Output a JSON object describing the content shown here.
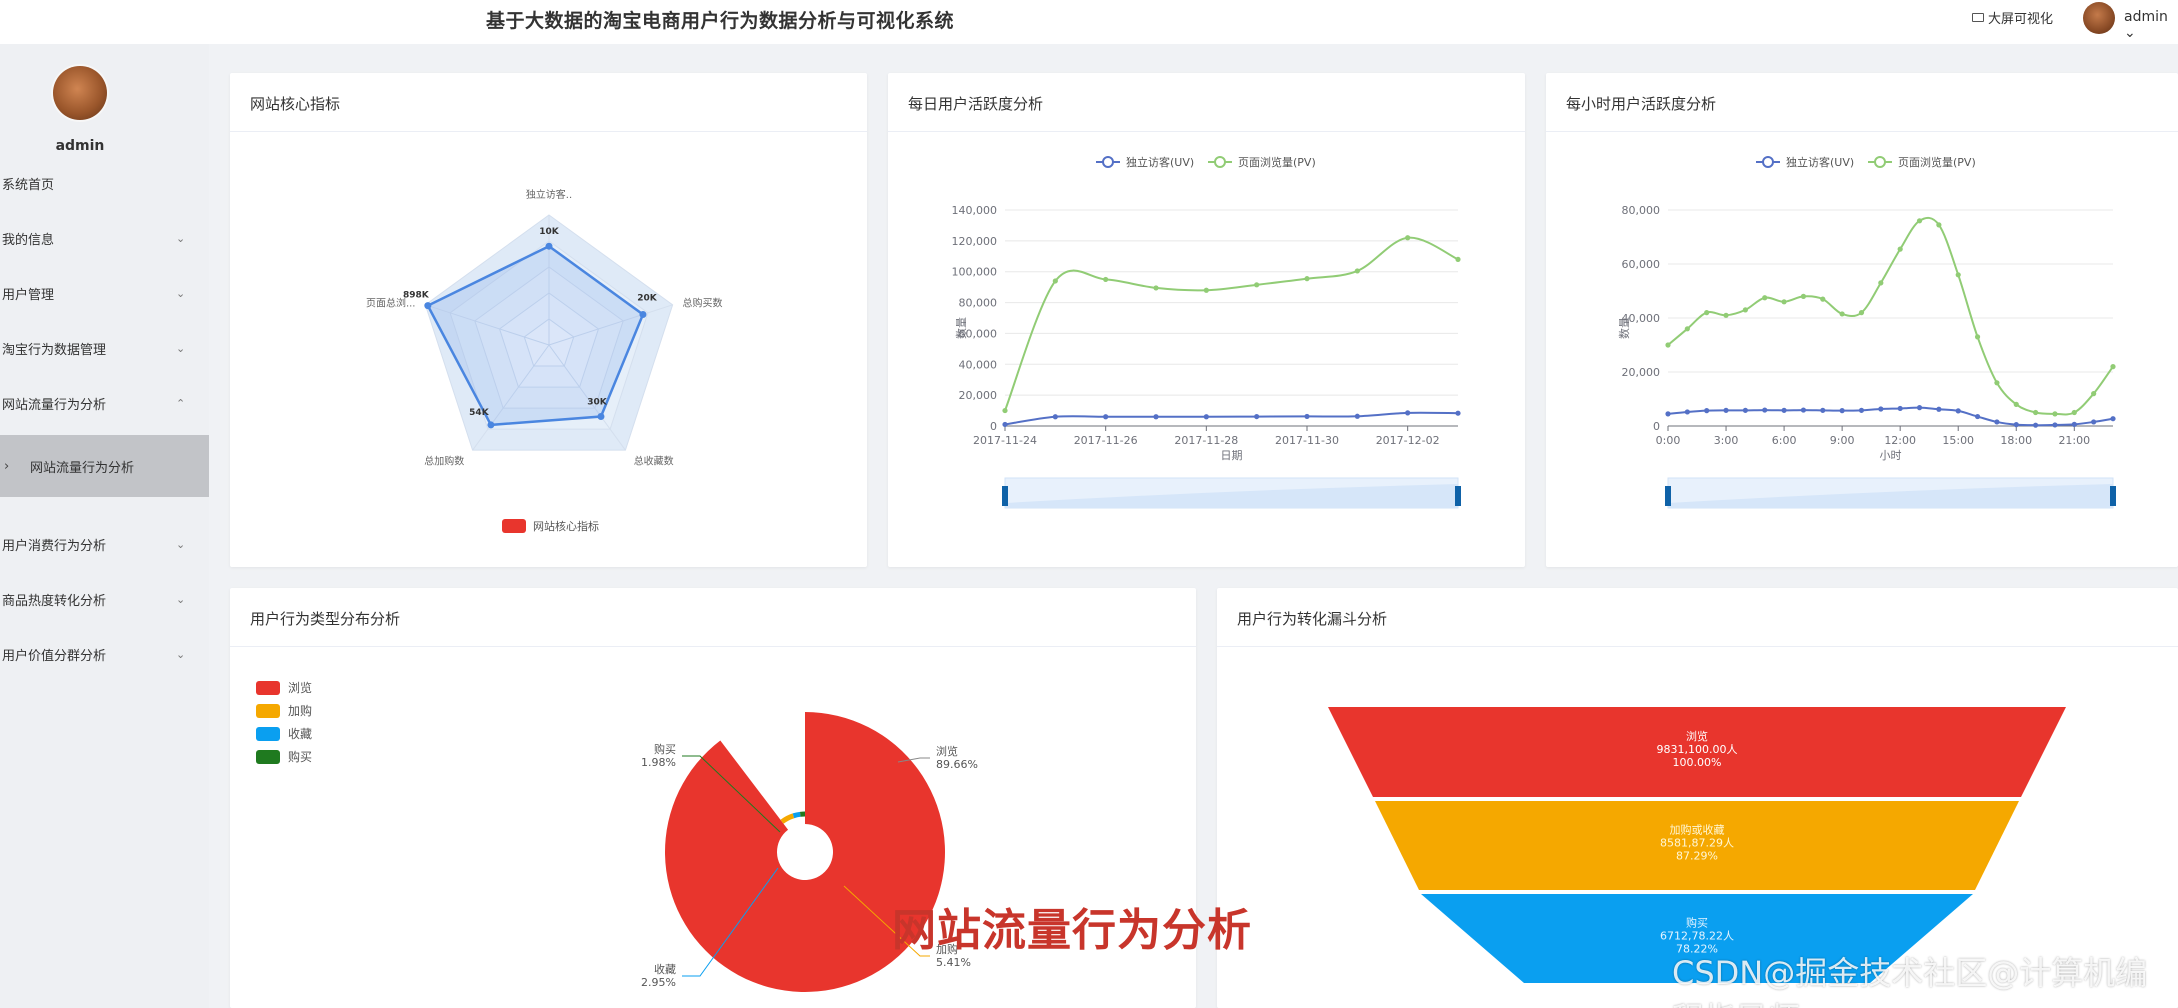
{
  "header": {
    "title": "基于大数据的淘宝电商用户行为数据分析与可视化系统",
    "bigscreen_label": "大屏可视化",
    "user_label": "admin"
  },
  "sidebar": {
    "username": "admin",
    "items": [
      {
        "label": "系统首页",
        "chevron": ""
      },
      {
        "label": "我的信息",
        "chevron": "⌄"
      },
      {
        "label": "用户管理",
        "chevron": "⌄"
      },
      {
        "label": "淘宝行为数据管理",
        "chevron": "⌄"
      },
      {
        "label": "网站流量行为分析",
        "chevron": "⌃"
      },
      {
        "label": "网站流量行为分析",
        "chevron": "",
        "active": true
      },
      {
        "label": "用户消费行为分析",
        "chevron": "⌄"
      },
      {
        "label": "商品热度转化分析",
        "chevron": "⌄"
      },
      {
        "label": "用户价值分群分析",
        "chevron": "⌄"
      }
    ]
  },
  "panels": {
    "radar_title": "网站核心指标",
    "daily_title": "每日用户活跃度分析",
    "hourly_title": "每小时用户活跃度分析",
    "pie_title": "用户行为类型分布分析",
    "funnel_title": "用户行为转化漏斗分析"
  },
  "colors": {
    "red": "#e8352d",
    "yellow": "#f5a800",
    "blue": "#0a9ff0",
    "green": "#1f7a1f",
    "uv": "#5470c6",
    "pv": "#91cc75"
  },
  "chart_data": [
    {
      "type": "radar",
      "indicators": [
        "独立访客..",
        "总购买数",
        "总收藏数",
        "总加购数",
        "页面总浏..."
      ],
      "series": [
        {
          "name": "网站核心指标",
          "values_labels": [
            "10K",
            "20K",
            "30K",
            "54K",
            "898K"
          ]
        }
      ],
      "legend": [
        "网站核心指标"
      ]
    },
    {
      "type": "line",
      "legend": [
        "独立访客(UV)",
        "页面浏览量(PV)"
      ],
      "x_ticks": [
        "2017-11-24",
        "2017-11-26",
        "2017-11-28",
        "2017-11-30",
        "2017-12-02"
      ],
      "xlabel": "日期",
      "ylabel": "数量",
      "y_ticks": [
        "0",
        "20,000",
        "40,000",
        "60,000",
        "80,000",
        "100,000",
        "120,000",
        "140,000"
      ],
      "ylim": [
        0,
        140000
      ],
      "x": [
        "2017-11-24",
        "2017-11-25",
        "2017-11-26",
        "2017-11-27",
        "2017-11-28",
        "2017-11-29",
        "2017-11-30",
        "2017-12-01",
        "2017-12-02",
        "2017-12-03"
      ],
      "series": [
        {
          "name": "独立访客(UV)",
          "values": [
            1000,
            6000,
            6000,
            6000,
            6000,
            6100,
            6200,
            6300,
            8500,
            8300
          ]
        },
        {
          "name": "页面浏览量(PV)",
          "values": [
            10000,
            94000,
            95000,
            89500,
            88000,
            91500,
            95500,
            100500,
            122000,
            108000
          ]
        }
      ]
    },
    {
      "type": "line",
      "legend": [
        "独立访客(UV)",
        "页面浏览量(PV)"
      ],
      "x_ticks": [
        "0:00",
        "3:00",
        "6:00",
        "9:00",
        "12:00",
        "15:00",
        "18:00",
        "21:00"
      ],
      "xlabel": "小时",
      "ylabel": "数量",
      "y_ticks": [
        "0",
        "20,000",
        "40,000",
        "60,000",
        "80,000"
      ],
      "ylim": [
        0,
        80000
      ],
      "x": [
        0,
        1,
        2,
        3,
        4,
        5,
        6,
        7,
        8,
        9,
        10,
        11,
        12,
        13,
        14,
        15,
        16,
        17,
        18,
        19,
        20,
        21,
        22,
        23
      ],
      "series": [
        {
          "name": "独立访客(UV)",
          "values": [
            4500,
            5200,
            5700,
            5800,
            5800,
            5900,
            5800,
            5900,
            5800,
            5700,
            5800,
            6300,
            6500,
            6800,
            6200,
            5600,
            3500,
            1500,
            500,
            300,
            400,
            600,
            1500,
            2700
          ]
        },
        {
          "name": "页面浏览量(PV)",
          "values": [
            30000,
            36000,
            42000,
            41000,
            43000,
            47500,
            46000,
            48000,
            47000,
            41500,
            42000,
            53000,
            65500,
            76000,
            74500,
            56000,
            33000,
            16000,
            8000,
            5000,
            4500,
            5000,
            12000,
            22000
          ]
        }
      ]
    },
    {
      "type": "pie",
      "legend": [
        "浏览",
        "加购",
        "收藏",
        "购买"
      ],
      "slices": [
        {
          "name": "浏览",
          "value": 89.66,
          "label": "89.66%"
        },
        {
          "name": "加购",
          "value": 5.41,
          "label": "5.41%"
        },
        {
          "name": "收藏",
          "value": 2.95,
          "label": "2.95%"
        },
        {
          "name": "购买",
          "value": 1.98,
          "label": "1.98%"
        }
      ]
    },
    {
      "type": "funnel",
      "stages": [
        {
          "name": "浏览",
          "value_text": "9831,100.00人",
          "pct_text": "100.00%"
        },
        {
          "name": "加购或收藏",
          "value_text": "8581,87.29人",
          "pct_text": "87.29%"
        },
        {
          "name": "购买",
          "value_text": "6712,78.22人",
          "pct_text": "78.22%"
        }
      ]
    }
  ],
  "overlay": {
    "caption": "网站流量行为分析",
    "watermark": "CSDN@掘金技术社区@计算机编程指导师"
  }
}
